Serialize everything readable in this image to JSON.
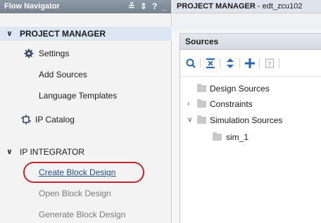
{
  "flow_navigator": {
    "title": "Flow Navigator",
    "tools": [
      "≚",
      "⇕",
      "?",
      "_"
    ],
    "sections": {
      "project_manager": {
        "label": "PROJECT MANAGER",
        "items": {
          "settings": "Settings",
          "add_sources": "Add Sources",
          "language_templates": "Language Templates",
          "ip_catalog": "IP Catalog"
        }
      },
      "ip_integrator": {
        "label": "IP INTEGRATOR",
        "items": {
          "create_block_design": "Create Block Design",
          "open_block_design": "Open Block Design",
          "generate_block_design": "Generate Block Design"
        }
      }
    }
  },
  "project_manager": {
    "title_bold": "PROJECT MANAGER",
    "title_rest": " - edt_zcu102",
    "sources": {
      "header": "Sources",
      "tree": {
        "design_sources": "Design Sources",
        "constraints": "Constraints",
        "simulation_sources": "Simulation Sources",
        "sim_1": "sim_1"
      }
    }
  },
  "colors": {
    "highlight_oval": "#c0262e",
    "link": "#1f4f8f",
    "toolbar_icon": "#2a66b8"
  }
}
